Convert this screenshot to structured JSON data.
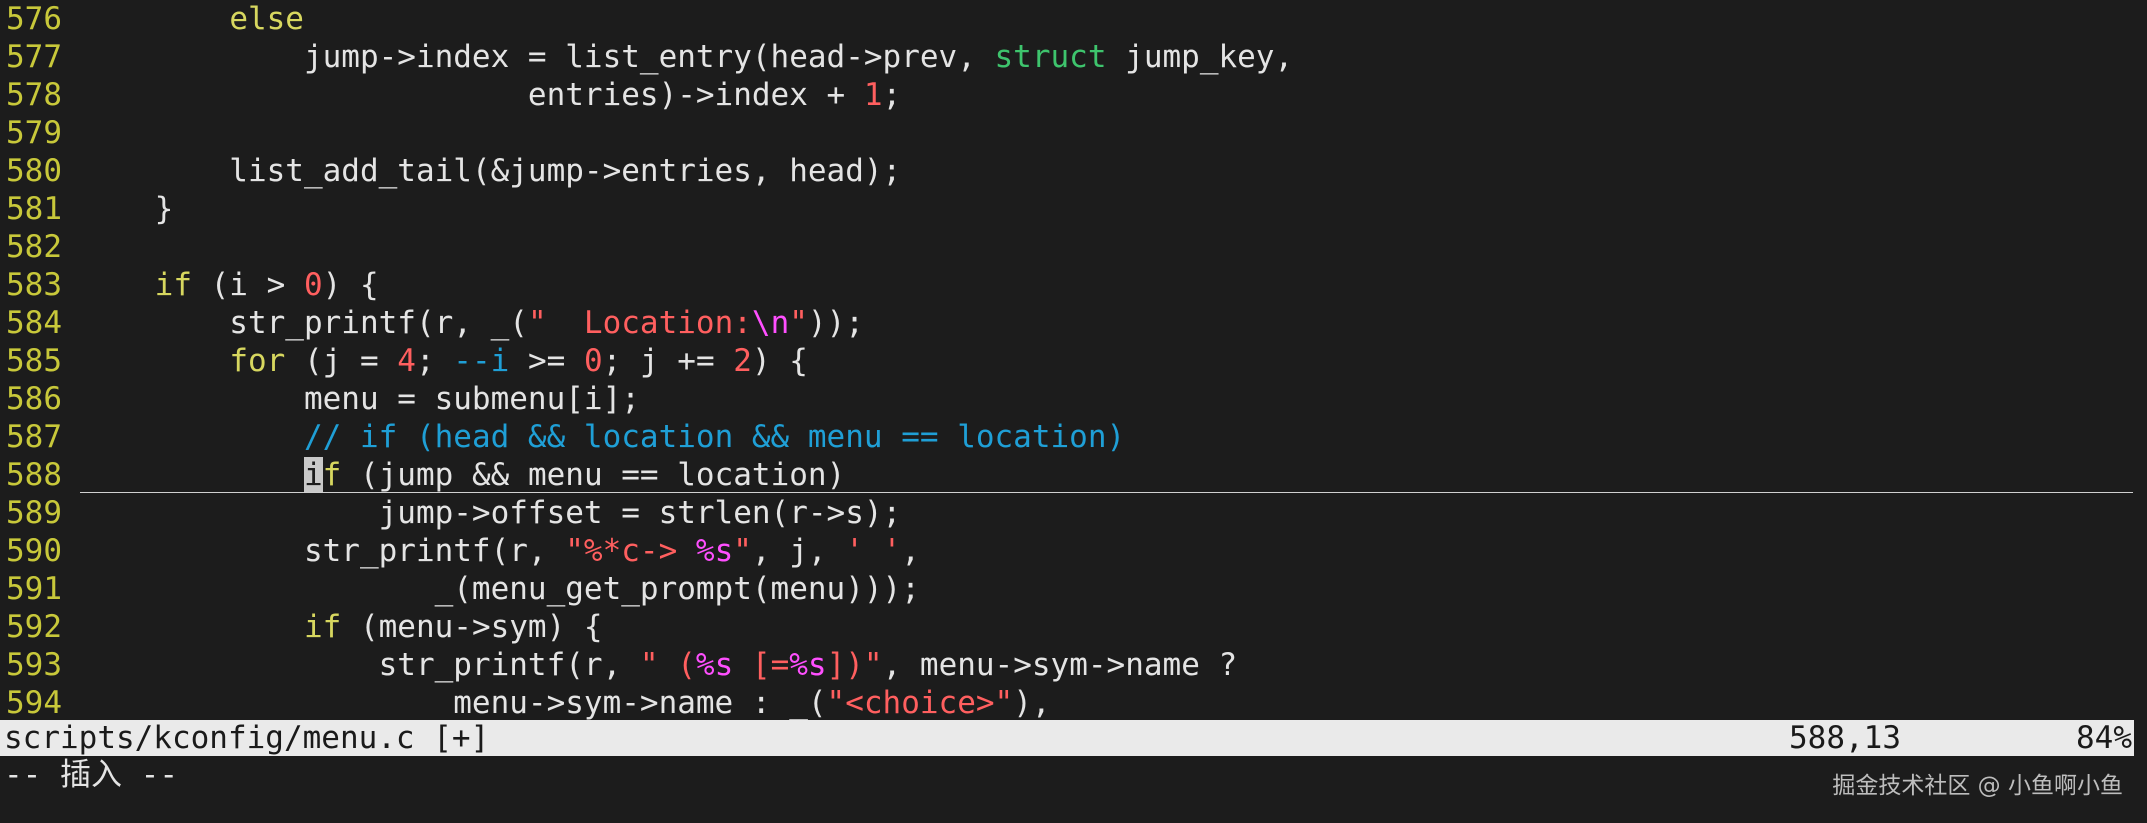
{
  "editor": {
    "lines": [
      {
        "n": "576",
        "tokens": [
          {
            "t": "        "
          },
          {
            "t": "else",
            "c": "kw"
          }
        ]
      },
      {
        "n": "577",
        "tokens": [
          {
            "t": "            jump->index = list_entry(head->prev, "
          },
          {
            "t": "struct",
            "c": "type"
          },
          {
            "t": " jump_key,"
          }
        ]
      },
      {
        "n": "578",
        "tokens": [
          {
            "t": "                        entries)->index + "
          },
          {
            "t": "1",
            "c": "num"
          },
          {
            "t": ";"
          }
        ]
      },
      {
        "n": "579",
        "tokens": []
      },
      {
        "n": "580",
        "tokens": [
          {
            "t": "        list_add_tail(&jump->entries, head);"
          }
        ]
      },
      {
        "n": "581",
        "tokens": [
          {
            "t": "    }"
          }
        ]
      },
      {
        "n": "582",
        "tokens": []
      },
      {
        "n": "583",
        "tokens": [
          {
            "t": "    "
          },
          {
            "t": "if",
            "c": "kw"
          },
          {
            "t": " (i > "
          },
          {
            "t": "0",
            "c": "num"
          },
          {
            "t": ") {"
          }
        ]
      },
      {
        "n": "584",
        "tokens": [
          {
            "t": "        str_printf(r, _("
          },
          {
            "t": "\"  Location:",
            "c": "str"
          },
          {
            "t": "\\n",
            "c": "esc"
          },
          {
            "t": "\"",
            "c": "str"
          },
          {
            "t": "));"
          }
        ]
      },
      {
        "n": "585",
        "tokens": [
          {
            "t": "        "
          },
          {
            "t": "for",
            "c": "kw"
          },
          {
            "t": " (j = "
          },
          {
            "t": "4",
            "c": "num"
          },
          {
            "t": "; "
          },
          {
            "t": "--i",
            "c": "op"
          },
          {
            "t": " >= "
          },
          {
            "t": "0",
            "c": "num"
          },
          {
            "t": "; j += "
          },
          {
            "t": "2",
            "c": "num"
          },
          {
            "t": ") {"
          }
        ]
      },
      {
        "n": "586",
        "tokens": [
          {
            "t": "            menu = submenu[i];"
          }
        ]
      },
      {
        "n": "587",
        "tokens": [
          {
            "t": "            "
          },
          {
            "t": "// if (head && location && menu == location)",
            "c": "cmt"
          }
        ]
      },
      {
        "n": "588",
        "cursorline": true,
        "tokens": [
          {
            "t": "            "
          },
          {
            "t": "i",
            "c": "cursor"
          },
          {
            "t": "f",
            "c": "kw"
          },
          {
            "t": " (jump && menu == location)"
          }
        ]
      },
      {
        "n": "589",
        "tokens": [
          {
            "t": "                jump->offset = strlen(r->s);"
          }
        ]
      },
      {
        "n": "590",
        "tokens": [
          {
            "t": "            str_printf(r, "
          },
          {
            "t": "\"%*c-> ",
            "c": "str"
          },
          {
            "t": "%s",
            "c": "esc"
          },
          {
            "t": "\"",
            "c": "str"
          },
          {
            "t": ", j, "
          },
          {
            "t": "' '",
            "c": "str"
          },
          {
            "t": ","
          }
        ]
      },
      {
        "n": "591",
        "tokens": [
          {
            "t": "                   _(menu_get_prompt(menu)));"
          }
        ]
      },
      {
        "n": "592",
        "tokens": [
          {
            "t": "            "
          },
          {
            "t": "if",
            "c": "kw"
          },
          {
            "t": " (menu->sym) {"
          }
        ]
      },
      {
        "n": "593",
        "tokens": [
          {
            "t": "                str_printf(r, "
          },
          {
            "t": "\" (",
            "c": "str"
          },
          {
            "t": "%s",
            "c": "esc"
          },
          {
            "t": " [=",
            "c": "str"
          },
          {
            "t": "%s",
            "c": "esc"
          },
          {
            "t": "])\"",
            "c": "str"
          },
          {
            "t": ", menu->sym->name ?"
          }
        ]
      },
      {
        "n": "594",
        "tokens": [
          {
            "t": "                    menu->sym->name : _("
          },
          {
            "t": "\"<choice>\"",
            "c": "str"
          },
          {
            "t": "),"
          }
        ]
      }
    ]
  },
  "statusline": {
    "filename": "scripts/kconfig/menu.c [+]",
    "position": "588,13",
    "percent": "84%"
  },
  "modeline": {
    "text": "-- 插入 --"
  },
  "watermark": {
    "text": "掘金技术社区 @ 小鱼啊小鱼"
  },
  "colors": {
    "background": "#1c1c1c",
    "foreground": "#e4e4e4",
    "line_number": "#c8c83a",
    "keyword": "#d7d75f",
    "type": "#3ec46d",
    "number_string": "#ff5f5f",
    "escape": "#ff4fff",
    "comment": "#1f9fd6",
    "statusline_bg": "#eaeaea"
  }
}
